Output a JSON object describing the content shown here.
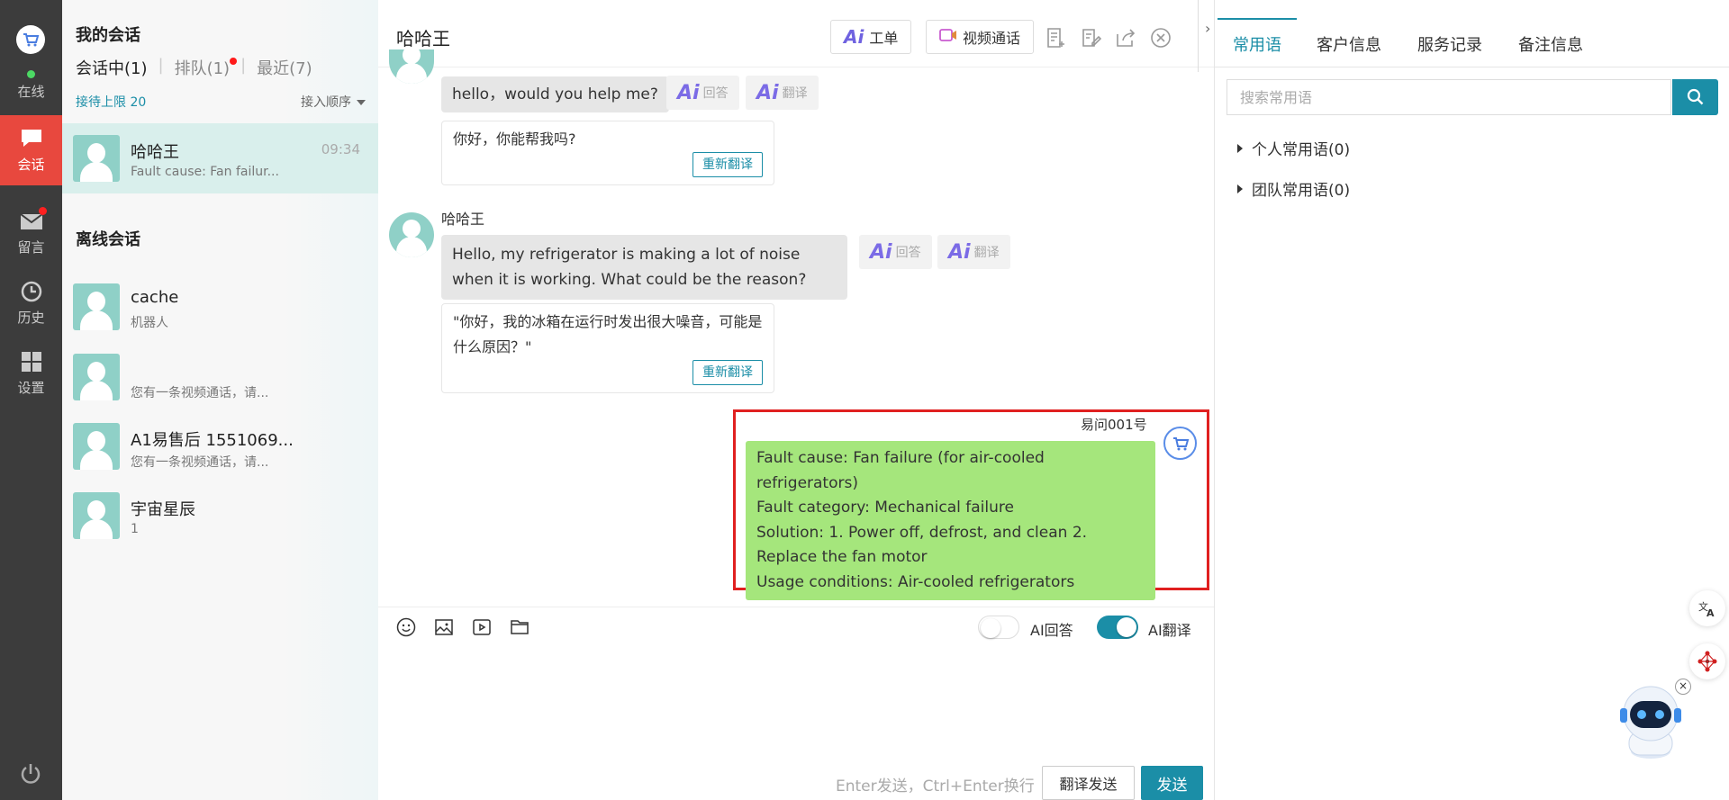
{
  "nav": {
    "status_label": "在线",
    "items": [
      {
        "label": "会话",
        "icon": "chat-icon"
      },
      {
        "label": "留言",
        "icon": "mail-icon"
      },
      {
        "label": "历史",
        "icon": "clock-icon"
      },
      {
        "label": "设置",
        "icon": "grid-icon"
      }
    ]
  },
  "conversations": {
    "header": "我的会话",
    "tabs": [
      "会话中(1)",
      "排队(1)",
      "最近(7)"
    ],
    "limit_text": "接待上限 20",
    "order_text": "接入顺序",
    "active": [
      {
        "name": "哈哈王",
        "preview": "Fault cause: Fan failur...",
        "time": "09:34"
      }
    ],
    "offline_header": "离线会话",
    "offline": [
      {
        "name": "cache",
        "preview": "机器人"
      },
      {
        "name": "",
        "preview": "您有一条视频通话，请..."
      },
      {
        "name": "A1易售后 1551069...",
        "preview": "您有一条视频通话，请..."
      },
      {
        "name": "宇宙星辰",
        "preview": "1"
      }
    ]
  },
  "chat": {
    "title": "哈哈王",
    "toolbar": {
      "ticket_label": "工单",
      "video_label": "视频通话",
      "ai_text": "Ai"
    },
    "ai_reply_label": "回答",
    "ai_translate_label": "翻译",
    "retranslate_label": "重新翻译",
    "messages": [
      {
        "text": "hello，would you help me?",
        "translation": "你好，你能帮我吗?"
      },
      {
        "sender": "哈哈王",
        "text": "Hello, my refrigerator is making a lot of noise when it is working. What could be the reason?",
        "translation": "\"你好，我的冰箱在运行时发出很大噪音，可能是什么原因？\""
      }
    ],
    "outgoing": {
      "sender": "易问001号",
      "lines": [
        "Fault cause: Fan failure (for air-cooled refrigerators)",
        "Fault category: Mechanical failure",
        "Solution: 1. Power off, defrost, and clean 2. Replace the fan motor",
        "Usage conditions: Air-cooled refrigerators"
      ]
    },
    "input": {
      "ai_reply_toggle_label": "AI回答",
      "ai_reply_on": false,
      "ai_translate_toggle_label": "AI翻译",
      "ai_translate_on": true,
      "hint": "Enter发送，Ctrl+Enter换行",
      "translate_send_label": "翻译发送",
      "send_label": "发送"
    }
  },
  "right_panel": {
    "tabs": [
      "常用语",
      "客户信息",
      "服务记录",
      "备注信息"
    ],
    "search_placeholder": "搜索常用语",
    "groups": [
      "个人常用语(0)",
      "团队常用语(0)"
    ]
  },
  "colors": {
    "accent": "#1b8ea7",
    "nav_bg": "#3c3c3c",
    "nav_active": "#e8483e",
    "outgoing_bubble": "#a5e67c",
    "highlight": "#e02020"
  }
}
